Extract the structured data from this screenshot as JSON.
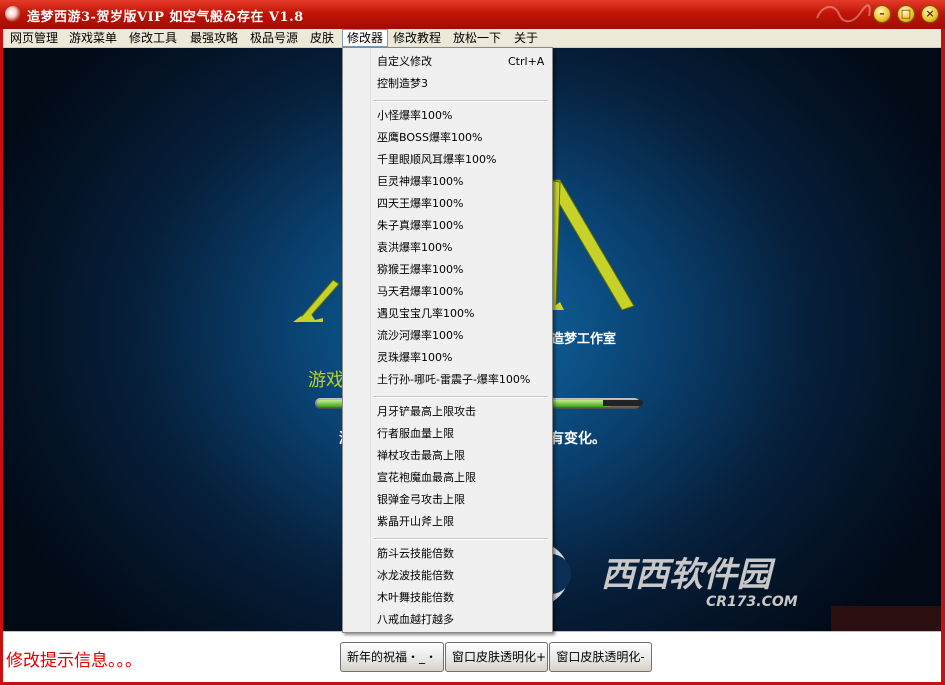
{
  "window": {
    "title": "造梦西游3-贺岁版VIP 如空气般ゐ存在 V1.8",
    "minimize_glyph": "–",
    "maximize_glyph": "□",
    "close_glyph": "×"
  },
  "menubar": {
    "items": [
      "网页管理",
      "游戏菜单",
      "修改工具",
      "最强攻略",
      "极品号源",
      "皮肤",
      "修改器",
      "修改教程",
      "放松一下",
      "关于"
    ],
    "active": "修改器"
  },
  "modifier_menu": {
    "group1": [
      {
        "label": "自定义修改",
        "shortcut": "Ctrl+A"
      },
      {
        "label": "控制造梦3"
      }
    ],
    "group2": [
      "小怪爆率100%",
      "巫鹰BOSS爆率100%",
      "千里眼顺风耳爆率100%",
      "巨灵神爆率100%",
      "四天王爆率100%",
      "朱子真爆率100%",
      "袁洪爆率100%",
      "猕猴王爆率100%",
      "马天君爆率100%",
      "遇见宝宝几率100%",
      "流沙河爆率100%",
      "灵珠爆率100%",
      "土行孙-哪吒-雷震子-爆率100%"
    ],
    "group3": [
      "月牙铲最高上限攻击",
      "行者服血量上限",
      "禅杖攻击最高上限",
      "宣花袍魔血最高上限",
      "银弹金弓攻击上限",
      "紫晶开山斧上限"
    ],
    "group4": [
      "筋斗云技能倍数",
      "冰龙波技能倍数",
      "木叶舞技能倍数",
      "八戒血越打越多"
    ]
  },
  "splash": {
    "studio_text": "造梦工作室",
    "game_text_partial": "游戏",
    "desc_left_partial": "游",
    "desc_right": "有变化。",
    "progress_fraction": 0.92,
    "watermark_main": "西西软件园",
    "watermark_sub": "CR173.COM"
  },
  "status": {
    "message": "修改提示信息。。。",
    "buttons": [
      "新年的祝福・_・",
      "窗口皮肤透明化+",
      "窗口皮肤透明化-"
    ]
  },
  "colors": {
    "title_red": "#c11507",
    "status_text": "#e00000",
    "logo_yellow": "#b6d02c"
  }
}
